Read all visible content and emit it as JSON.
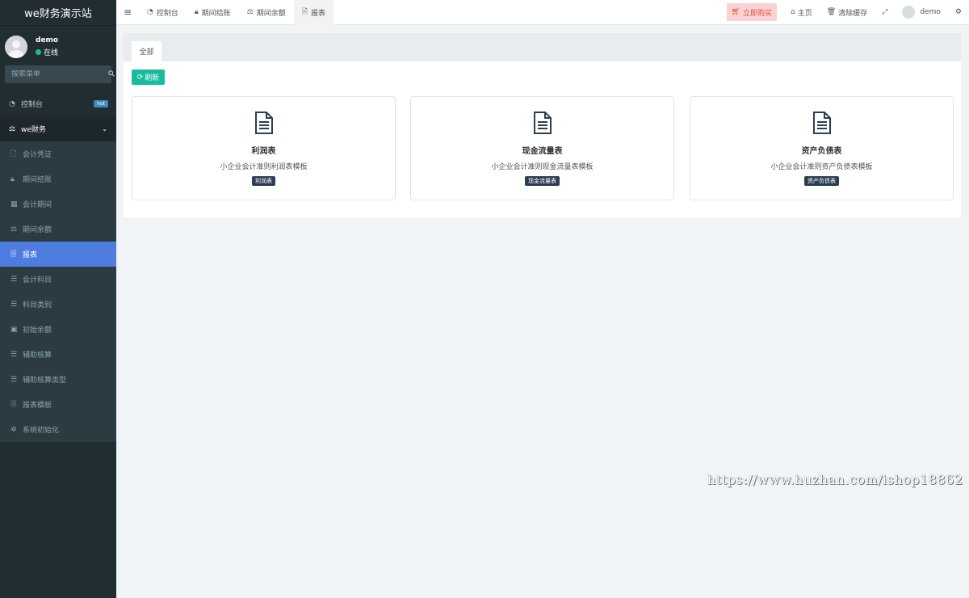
{
  "sidebar": {
    "logo": "we财务演示站",
    "user": {
      "name": "demo",
      "status": "在线"
    },
    "search_placeholder": "搜索菜单",
    "items": [
      {
        "label": "控制台",
        "icon": "dashboard-icon",
        "badge": "hot"
      },
      {
        "label": "we财务",
        "icon": "balance-scale-icon"
      },
      {
        "label": "会计凭证",
        "icon": "file-icon"
      },
      {
        "label": "期间结账",
        "icon": "lock-icon"
      },
      {
        "label": "会计期间",
        "icon": "calendar-icon"
      },
      {
        "label": "期间余额",
        "icon": "balance-scale-icon"
      },
      {
        "label": "报表",
        "icon": "file-text-icon"
      },
      {
        "label": "会计科目",
        "icon": "list-icon"
      },
      {
        "label": "科目类别",
        "icon": "list-icon"
      },
      {
        "label": "初始余额",
        "icon": "money-icon"
      },
      {
        "label": "辅助核算",
        "icon": "list-icon"
      },
      {
        "label": "辅助核算类型",
        "icon": "list-icon"
      },
      {
        "label": "报表模板",
        "icon": "file-text-icon"
      },
      {
        "label": "系统初始化",
        "icon": "gear-icon"
      }
    ]
  },
  "topbar": {
    "tabs": [
      {
        "label": "控制台",
        "icon": "dashboard-icon"
      },
      {
        "label": "期间结账",
        "icon": "lock-icon"
      },
      {
        "label": "期间余额",
        "icon": "balance-scale-icon"
      },
      {
        "label": "报表",
        "icon": "file-text-icon"
      }
    ],
    "buy_label": "立即购买",
    "home_label": "主页",
    "clear_cache_label": "清除缓存",
    "user_label": "demo"
  },
  "content": {
    "tab_all": "全部",
    "refresh_label": "刷新",
    "cards": [
      {
        "title": "利润表",
        "desc": "小企业会计准则利润表模板",
        "tag": "利润表"
      },
      {
        "title": "现金流量表",
        "desc": "小企业会计准则现金流量表模板",
        "tag": "现金流量表"
      },
      {
        "title": "资产负债表",
        "desc": "小企业会计准则资产负债表模板",
        "tag": "资产负债表"
      }
    ]
  },
  "watermark": "https://www.huzhan.com/ishop18862",
  "colors": {
    "sidebar_bg": "#222d32",
    "active_menu": "#4f7ddf",
    "refresh_btn": "#18bc9c",
    "buy_btn_bg": "#f9d3d3",
    "tag_bg": "#2c3e50"
  }
}
